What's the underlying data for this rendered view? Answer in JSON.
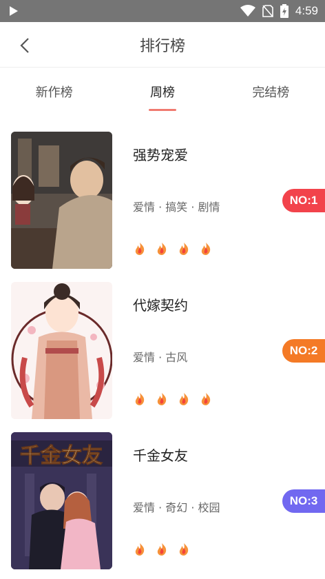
{
  "status_bar": {
    "time": "4:59"
  },
  "header": {
    "title": "排行榜"
  },
  "tabs": [
    {
      "label": "新作榜"
    },
    {
      "label": "周榜"
    },
    {
      "label": "完结榜"
    }
  ],
  "items": [
    {
      "title": "强势宠爱",
      "tags": "爱情 · 搞笑 · 剧情",
      "badge": "NO:1",
      "badge_color": "#f2434b",
      "flames": 4
    },
    {
      "title": "代嫁契约",
      "tags": "爱情 · 古风",
      "badge": "NO:2",
      "badge_color": "#f47a26",
      "flames": 4
    },
    {
      "title": "千金女友",
      "tags": "爱情 · 奇幻 · 校园",
      "badge": "NO:3",
      "badge_color": "#7168f0",
      "flames": 3,
      "cover_text": "千金女友"
    }
  ]
}
